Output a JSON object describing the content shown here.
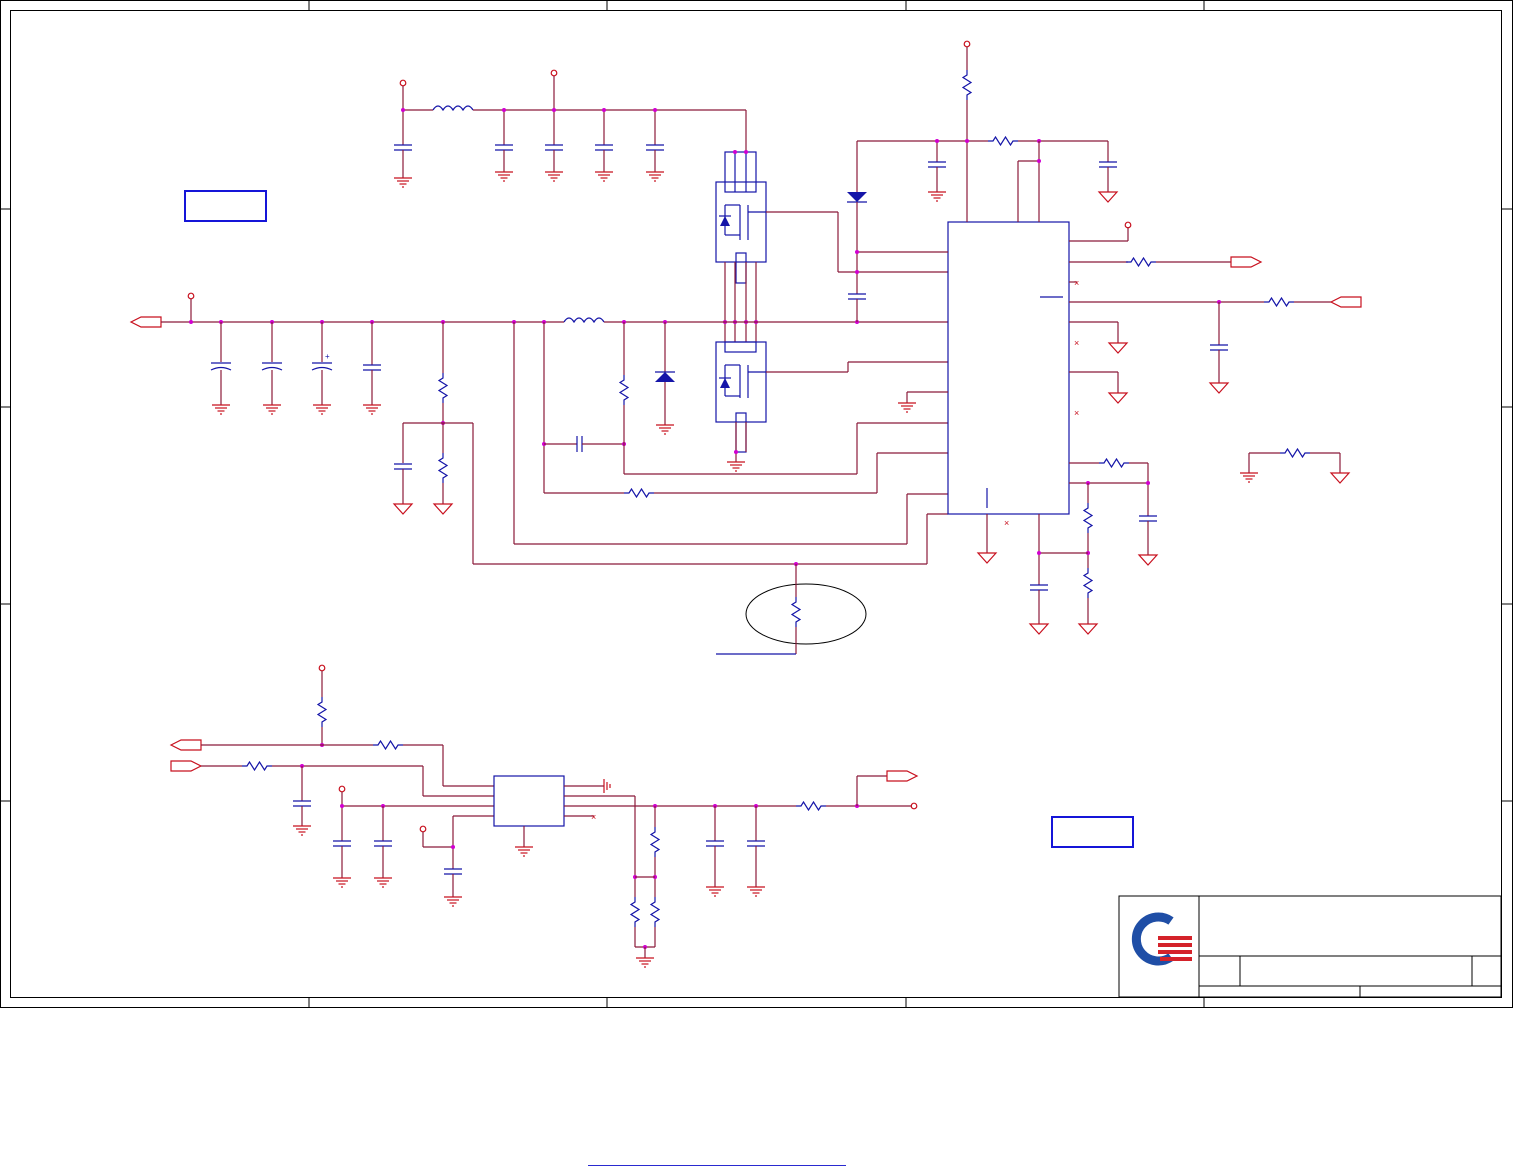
{
  "colors": {
    "wire": "#8b1a3a",
    "component": "#1515a8",
    "power": "#c8101e",
    "junction": "#d100d1",
    "frame": "#000000",
    "logo_blue": "#1f4ea6",
    "logo_red": "#d4222a"
  },
  "icons": [
    "vcc-rail-icon",
    "ground-icon",
    "resistor-icon",
    "capacitor-icon",
    "inductor-icon",
    "diode-icon",
    "mosfet-icon",
    "offpage-connector-icon",
    "company-logo-icon"
  ],
  "title_block": {
    "logo": "company-logo-icon"
  }
}
